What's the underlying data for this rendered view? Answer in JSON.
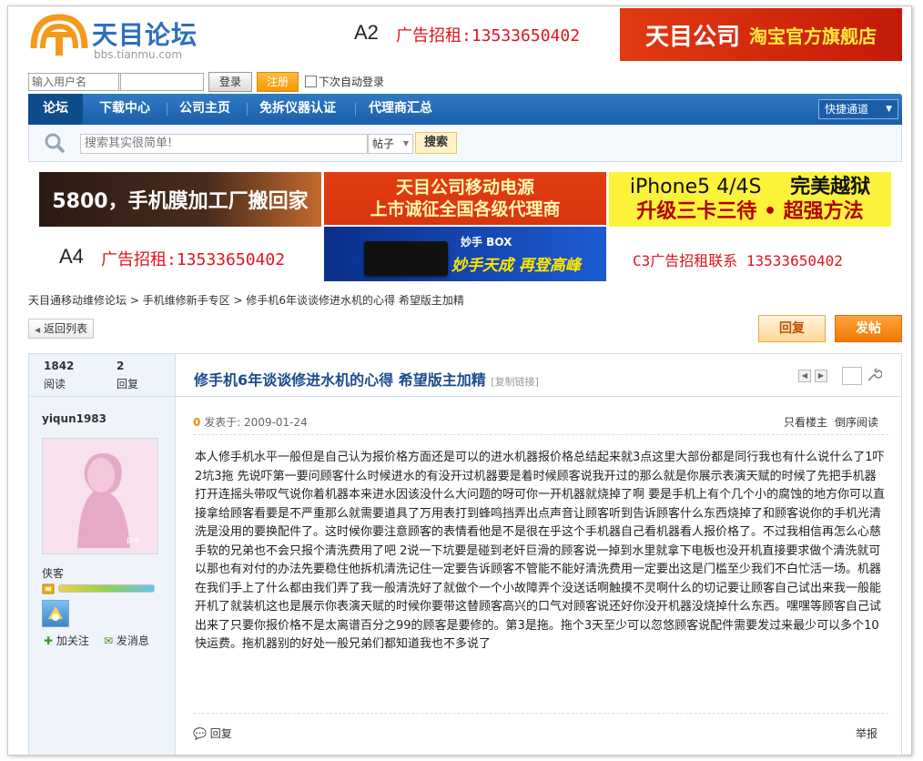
{
  "header": {
    "logo_text": "天目论坛",
    "logo_url": "bbs.tianmu.com",
    "a2_label": "A2",
    "a2_ad": "广告招租:13533650402",
    "banner_left": "天目公司",
    "banner_right": "淘宝官方旗舰店"
  },
  "login": {
    "username_placeholder": "输入用户名",
    "login_label": "登录",
    "register_label": "注册",
    "remember_label": "下次自动登录"
  },
  "nav": {
    "items": [
      "论坛",
      "下载中心",
      "公司主页",
      "免拆仪器认证",
      "代理商汇总"
    ],
    "quick_label": "快捷通道"
  },
  "search": {
    "placeholder": "搜索其实很简单!",
    "type_label": "帖子",
    "button_label": "搜索"
  },
  "ads": {
    "ad1": "5800，手机膜加工厂搬回家",
    "ad2_line1": "天目公司移动电源",
    "ad2_line2": "上市诚征全国各级代理商",
    "ad2b_title": "妙手 BOX",
    "ad2b_slogan": "妙手天成 再登高峰",
    "ad3_line1_a": "iPhone5 4/4S",
    "ad3_line1_b": "完美越狱",
    "ad3_line2": "升级三卡三待 • 超强方法",
    "a4_label": "A4",
    "a4_ad": "广告招租:13533650402",
    "c3_ad": "C3广告招租联系 13533650402"
  },
  "breadcrumb": "天目通移动维修论坛 > 手机维修新手专区 > 修手机6年谈谈修进水机的心得 希望版主加精",
  "actions": {
    "back_label": "返回列表",
    "reply_label": "回复",
    "post_label": "发帖"
  },
  "thread": {
    "views": "1842",
    "views_label": "阅读",
    "replies": "2",
    "replies_label": "回复",
    "title": "修手机6年谈谈修进水机的心得 希望版主加精",
    "copy_link": "[复制链接]"
  },
  "author": {
    "name": "yiqun1983",
    "rank": "侠客",
    "follow_label": "加关注",
    "message_label": "发消息"
  },
  "post": {
    "floor": "0",
    "posted_at": "发表于: 2009-01-24",
    "only_author": "只看楼主",
    "reverse": "倒序阅读",
    "body": "本人修手机水平一般但是自己认为报价格方面还是可以的进水机器报价格总结起来就3点这里大部份都是同行我也有什么说什么了1吓2坑3拖   先说吓第一要问顾客什么时候进水的有没开过机器要是着时候顾客说我开过的那么就是你展示表演天赋的时候了先把手机器打开连摇头带叹气说你着机器本来进水因该没什么大问题的呀可你一开机器就烧掉了啊 要是手机上有个几个小的腐蚀的地方你可以直接拿给顾客看要是不严重那么就需要道具了万用表打到蜂鸣挡弄出点声音让顾客听到告诉顾客什么东西烧掉了和顾客说你的手机光清洗是没用的要换配件了。这时候你要注意顾客的表情看他是不是很在乎这个手机器自己看机器看人报价格了。不过我相信再怎么心慈手软的兄弟也不会只报个清洗费用了吧   2说一下坑要是碰到老奸巨滑的顾客说一掉到水里就拿下电板也没开机直接要求做个清洗就可以那也有对付的办法先要稳住他拆机清洗记住一定要告诉顾客不管能不能好清洗费用一定要出这是门槛至少我们不白忙活一场。机器在我们手上了什么都由我们弄了我一般清洗好了就做个一个小故障弄个没送话啊触摸不灵啊什么的切记要让顾客自己试出来我一般能开机了就装机这也是展示你表演天赋的时候你要带这替顾客高兴的口气对顾客说还好你没开机器没烧掉什么东西。嘿嘿等顾客自己试出来了只要你报价格不是太离谱百分之99的顾客是要修的。第3是拖。拖个3天至少可以忽悠顾客说配件需要发过来最少可以多个10快运费。拖机器别的好处一般兄弟们都知道我也不多说了",
    "reply_label": "回复",
    "report_label": "举报"
  },
  "colors": {
    "nav_blue": "#1a5ea9",
    "ad_red": "#e0141e",
    "title_blue": "#1a4d8c",
    "post_orange": "#f07800"
  }
}
